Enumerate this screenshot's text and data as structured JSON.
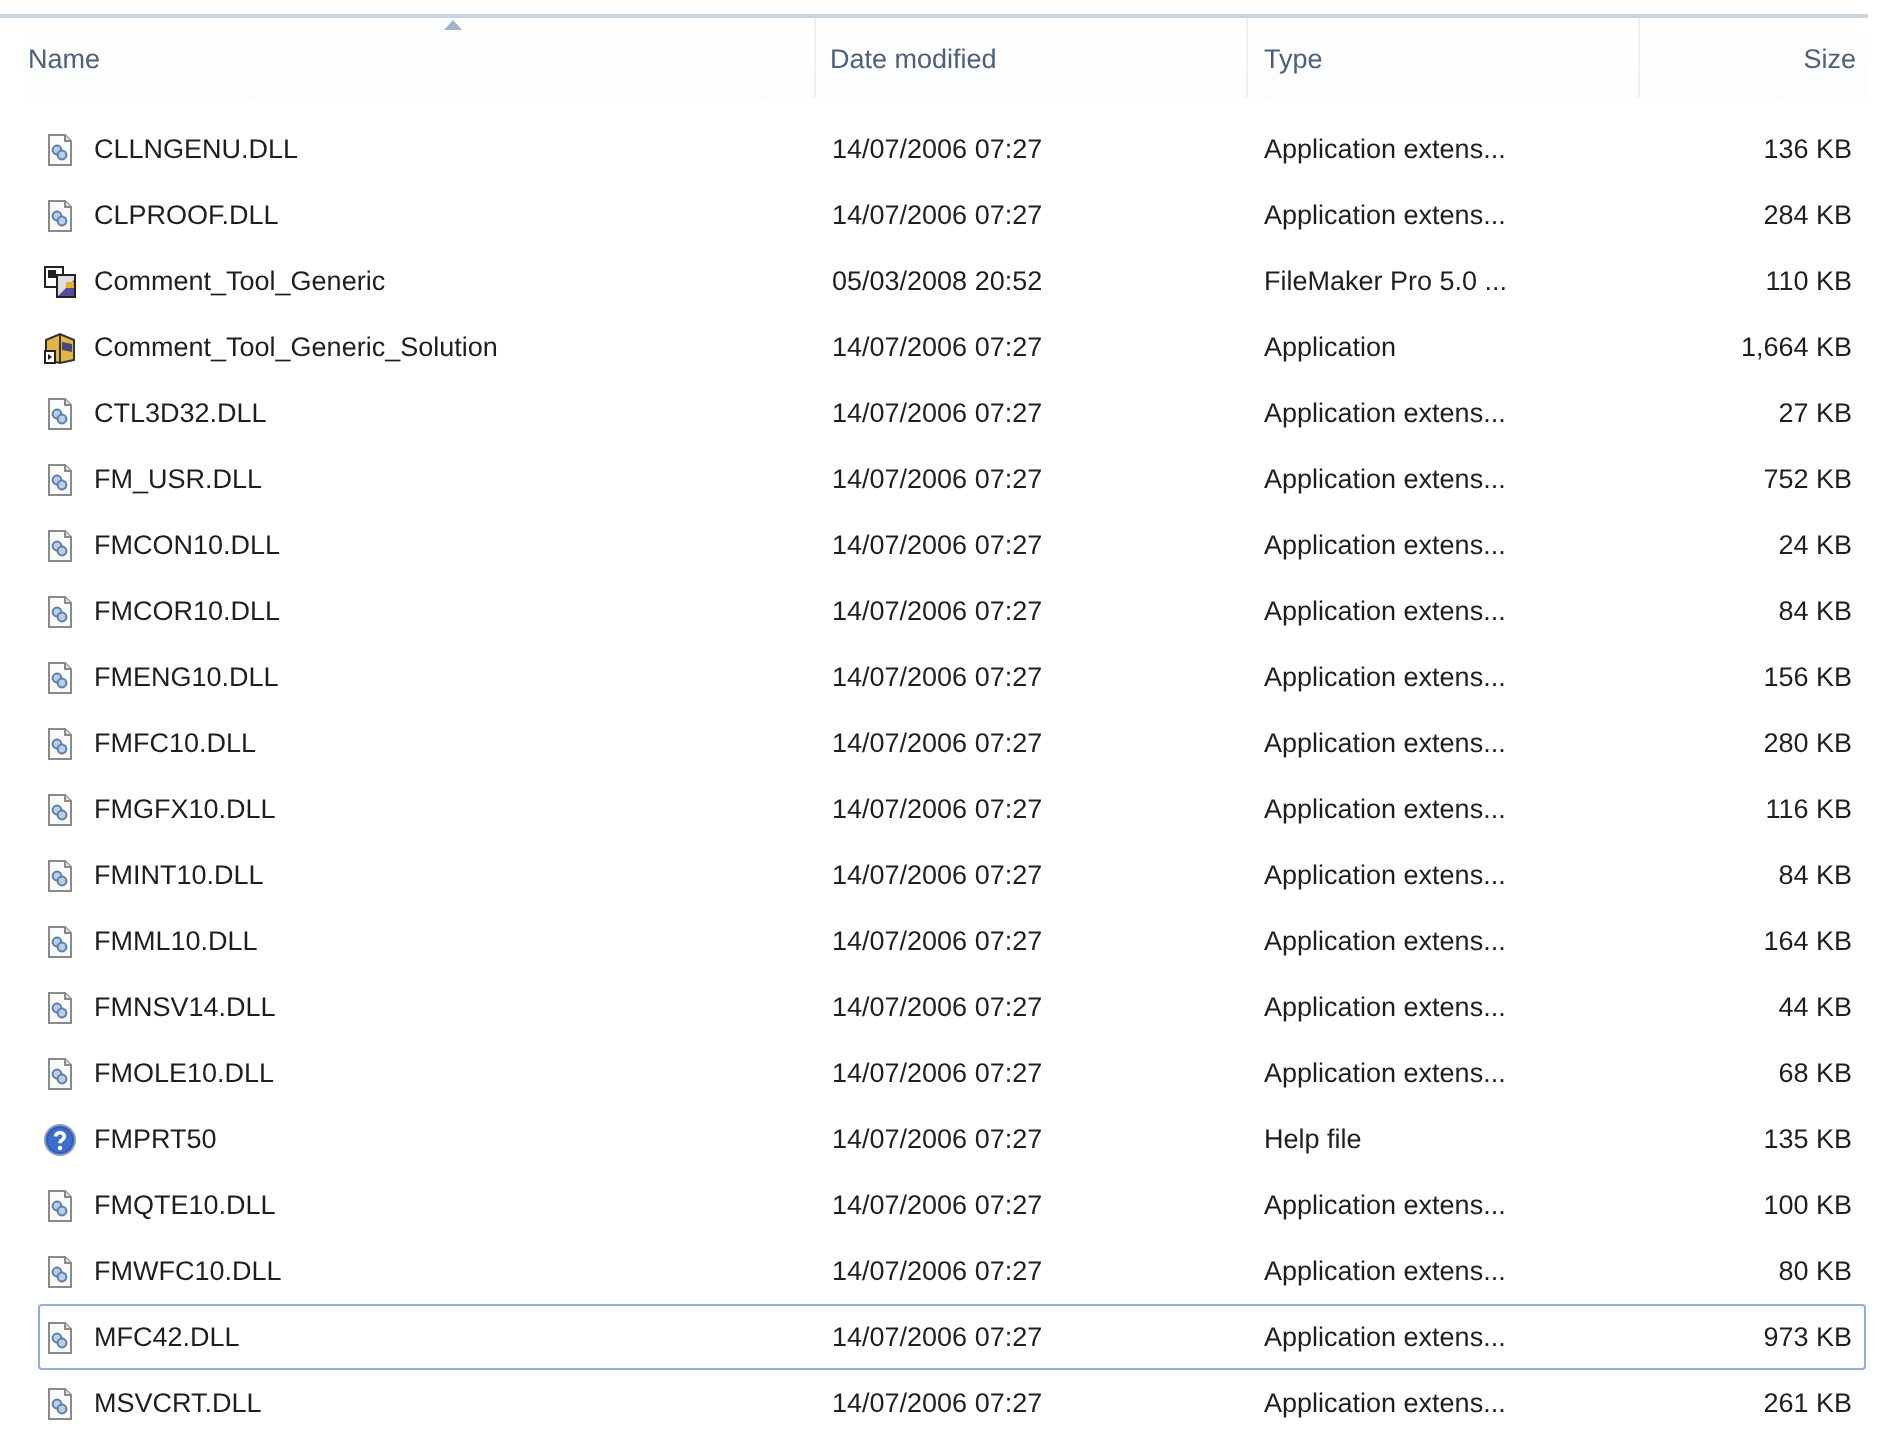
{
  "columns": [
    {
      "label": "Name",
      "sorted": true
    },
    {
      "label": "Date modified",
      "sorted": false
    },
    {
      "label": "Type",
      "sorted": false
    },
    {
      "label": "Size",
      "sorted": false
    }
  ],
  "rows": [
    {
      "kind": "dll",
      "name": "CLLNGENU.DLL",
      "date": "14/07/2006 07:27",
      "type": "Application extens...",
      "size": "136 KB",
      "focused": false
    },
    {
      "kind": "dll",
      "name": "CLPROOF.DLL",
      "date": "14/07/2006 07:27",
      "type": "Application extens...",
      "size": "284 KB",
      "focused": false
    },
    {
      "kind": "database",
      "name": "Comment_Tool_Generic",
      "date": "05/03/2008 20:52",
      "type": "FileMaker Pro 5.0 ...",
      "size": "110 KB",
      "focused": false
    },
    {
      "kind": "app",
      "name": "Comment_Tool_Generic_Solution",
      "date": "14/07/2006 07:27",
      "type": "Application",
      "size": "1,664 KB",
      "focused": false
    },
    {
      "kind": "dll",
      "name": "CTL3D32.DLL",
      "date": "14/07/2006 07:27",
      "type": "Application extens...",
      "size": "27 KB",
      "focused": false
    },
    {
      "kind": "dll",
      "name": "FM_USR.DLL",
      "date": "14/07/2006 07:27",
      "type": "Application extens...",
      "size": "752 KB",
      "focused": false
    },
    {
      "kind": "dll",
      "name": "FMCON10.DLL",
      "date": "14/07/2006 07:27",
      "type": "Application extens...",
      "size": "24 KB",
      "focused": false
    },
    {
      "kind": "dll",
      "name": "FMCOR10.DLL",
      "date": "14/07/2006 07:27",
      "type": "Application extens...",
      "size": "84 KB",
      "focused": false
    },
    {
      "kind": "dll",
      "name": "FMENG10.DLL",
      "date": "14/07/2006 07:27",
      "type": "Application extens...",
      "size": "156 KB",
      "focused": false
    },
    {
      "kind": "dll",
      "name": "FMFC10.DLL",
      "date": "14/07/2006 07:27",
      "type": "Application extens...",
      "size": "280 KB",
      "focused": false
    },
    {
      "kind": "dll",
      "name": "FMGFX10.DLL",
      "date": "14/07/2006 07:27",
      "type": "Application extens...",
      "size": "116 KB",
      "focused": false
    },
    {
      "kind": "dll",
      "name": "FMINT10.DLL",
      "date": "14/07/2006 07:27",
      "type": "Application extens...",
      "size": "84 KB",
      "focused": false
    },
    {
      "kind": "dll",
      "name": "FMML10.DLL",
      "date": "14/07/2006 07:27",
      "type": "Application extens...",
      "size": "164 KB",
      "focused": false
    },
    {
      "kind": "dll",
      "name": "FMNSV14.DLL",
      "date": "14/07/2006 07:27",
      "type": "Application extens...",
      "size": "44 KB",
      "focused": false
    },
    {
      "kind": "dll",
      "name": "FMOLE10.DLL",
      "date": "14/07/2006 07:27",
      "type": "Application extens...",
      "size": "68 KB",
      "focused": false
    },
    {
      "kind": "help",
      "name": "FMPRT50",
      "date": "14/07/2006 07:27",
      "type": "Help file",
      "size": "135 KB",
      "focused": false
    },
    {
      "kind": "dll",
      "name": "FMQTE10.DLL",
      "date": "14/07/2006 07:27",
      "type": "Application extens...",
      "size": "100 KB",
      "focused": false
    },
    {
      "kind": "dll",
      "name": "FMWFC10.DLL",
      "date": "14/07/2006 07:27",
      "type": "Application extens...",
      "size": "80 KB",
      "focused": false
    },
    {
      "kind": "dll",
      "name": "MFC42.DLL",
      "date": "14/07/2006 07:27",
      "type": "Application extens...",
      "size": "973 KB",
      "focused": true
    },
    {
      "kind": "dll",
      "name": "MSVCRT.DLL",
      "date": "14/07/2006 07:27",
      "type": "Application extens...",
      "size": "261 KB",
      "focused": false
    }
  ]
}
